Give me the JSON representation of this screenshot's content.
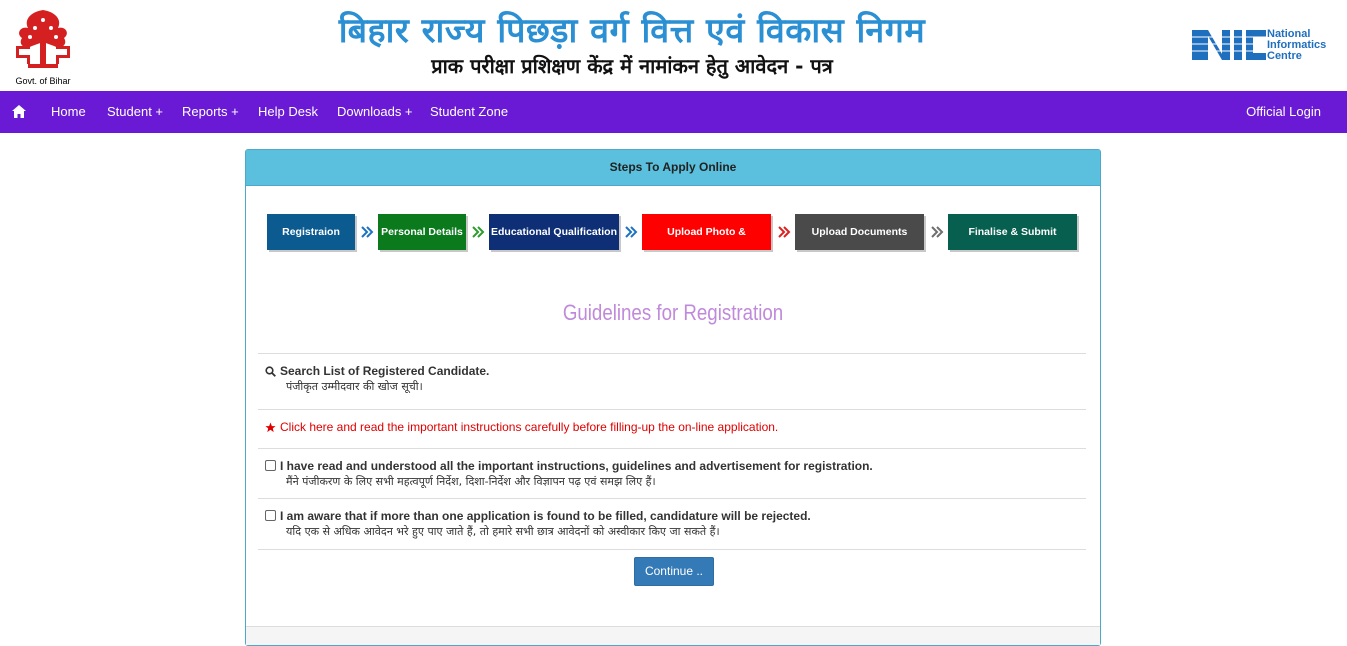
{
  "header": {
    "emblem_caption": "Govt. of Bihar",
    "title": "बिहार राज्य पिछड़ा वर्ग वित्त एवं विकास निगम",
    "subtitle": "प्राक परीक्षा प्रशिक्षण केंद्र में नामांकन हेतु आवेदन - पत्र",
    "nic_lines": [
      "National",
      "Informatics",
      "Centre"
    ]
  },
  "nav": {
    "items": [
      "Home",
      "Student +",
      "Reports +",
      "Help Desk",
      "Downloads +",
      "Student Zone"
    ],
    "right": "Official Login"
  },
  "panel": {
    "heading": "Steps To Apply Online",
    "steps": [
      {
        "label": "Registraion",
        "color": "#0b5b91"
      },
      {
        "label": "Personal Details",
        "color": "#0a7a1d"
      },
      {
        "label": "Educational Qualification",
        "color": "#0e2f76"
      },
      {
        "label": "Upload Photo & Signature",
        "color": "#ff0000"
      },
      {
        "label": "Upload Documents",
        "color": "#4a4a4a"
      },
      {
        "label": "Finalise & Submit",
        "color": "#07604f"
      }
    ],
    "chevron_colors": [
      "#1d73c2",
      "#2e9b2e",
      "#1d73c2",
      "#e02020",
      "#6e6e6e"
    ],
    "guidelines_title": "Guidelines for Registration",
    "search": {
      "line1": "Search List of Registered Candidate.",
      "line2": "पंजीकृत उम्मीदवार की खोज सूची।"
    },
    "instructions_link": "Click here and read the important instructions carefully before filling-up the on-line application.",
    "agree1": {
      "line1": "I have read and understood all the important instructions, guidelines and advertisement for registration.",
      "line2": "मैंने पंजीकरण के लिए सभी महत्वपूर्ण निर्देश, दिशा-निर्देश और विज्ञापन पढ़ एवं समझ लिए हैं।"
    },
    "agree2": {
      "line1": "I am aware that if more than one application is found to be filled, candidature will be rejected.",
      "line2": "यदि एक से अधिक आवेदन भरे हुए पाए जाते हैं, तो हमारे सभी छात्र आवेदनों को अस्वीकार किए जा सकते हैं।"
    },
    "continue_label": "Continue .."
  }
}
